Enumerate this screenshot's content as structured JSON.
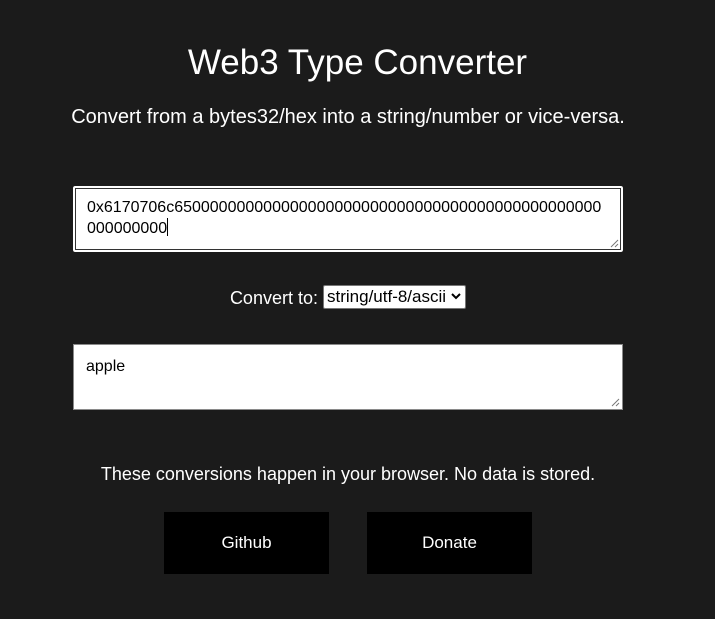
{
  "page": {
    "title": "Web3 Type Converter",
    "subtitle": "Convert from a bytes32/hex into a string/number or vice-versa."
  },
  "input": {
    "value": "0x6170706c650000000000000000000000000000000000000000000000000000000"
  },
  "convert": {
    "label": "Convert to:",
    "selected": "string/utf-8/ascii"
  },
  "output": {
    "value": "apple"
  },
  "note": "These conversions happen in your browser. No data is stored.",
  "buttons": {
    "github": "Github",
    "donate": "Donate"
  },
  "colors": {
    "background": "#1b1b1b",
    "text": "#ffffff",
    "button_bg": "#000000"
  }
}
